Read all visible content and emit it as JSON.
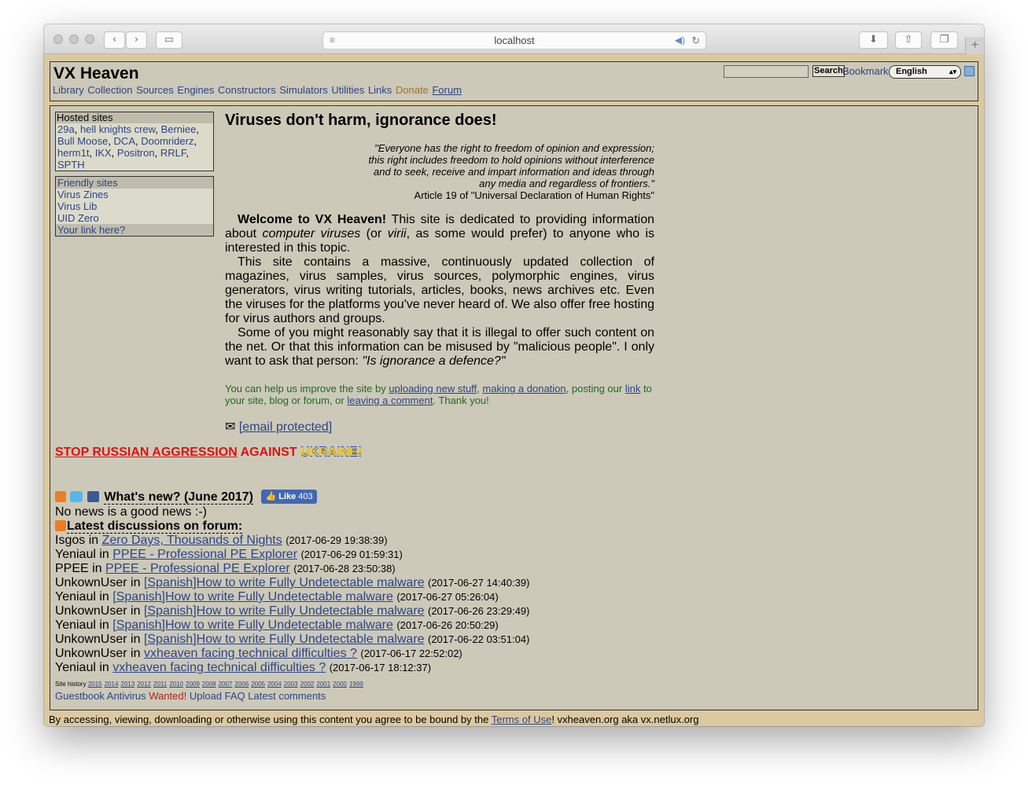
{
  "browser": {
    "url": "localhost"
  },
  "header": {
    "site_title": "VX Heaven",
    "menu": [
      "Library",
      "Collection",
      "Sources",
      "Engines",
      "Constructors",
      "Simulators",
      "Utilities",
      "Links"
    ],
    "donate": "Donate",
    "forum": "Forum",
    "search_button": "Search",
    "bookmark": "Bookmark",
    "language": "English"
  },
  "sidebar": {
    "hosted_title": "Hosted sites",
    "hosted_sites": [
      "29a",
      "hell knights crew",
      "Berniee",
      "Bull Moose",
      "DCA",
      "Doomriderz",
      "herm1t",
      "IKX",
      "Positron",
      "RRLF",
      "SPTH"
    ],
    "friendly_title": "Friendly sites",
    "friendly_sites": [
      "Virus Zines",
      "Virus Lib",
      "UID Zero",
      "Your link here?"
    ]
  },
  "content": {
    "headline": "Viruses don't harm, ignorance does!",
    "quote_lines": [
      "\"Everyone has the right to freedom of opinion and expression;",
      "this right includes freedom to hold opinions without interference",
      "and to seek, receive and impart information and ideas through",
      "any media and regardless of frontiers.\""
    ],
    "quote_source": "Article 19 of \"Universal Declaration of Human Rights\"",
    "welcome_bold": "Welcome to VX Heaven!",
    "welcome_p1_a": " This site is dedicated to providing information about ",
    "welcome_p1_em1": "computer viruses",
    "welcome_p1_b": " (or ",
    "welcome_p1_em2": "virii",
    "welcome_p1_c": ", as some would prefer) to anyone who is interested in this topic.",
    "welcome_p2": "This site contains a massive, continuously updated collection of magazines, virus samples, virus sources, polymorphic engines, virus generators, virus writing tutorials, articles, books, news archives etc. Even the viruses for the platforms you've never heard of. We also offer free hosting for virus authors and groups.",
    "welcome_p3_a": "Some of you might reasonably say that it is illegal to offer such content on the net. Or that this information can be misused by \"malicious people\". I only want to ask that person: ",
    "welcome_p3_em": "\"Is ignorance a defence?\"",
    "help_a": "You can help us improve the site by ",
    "help_link1": "uploading new stuff",
    "help_b": ", ",
    "help_link2": "making a donation",
    "help_c": ", posting our ",
    "help_link3": "link",
    "help_d": " to your site, blog or forum, or ",
    "help_link4": "leaving a comment",
    "help_e": ". Thank you!",
    "email_icon": "✉",
    "email_link": "[email protected]"
  },
  "banner": {
    "part1": "STOP RUSSIAN AGGRESSION",
    "part2": " AGAINST ",
    "part3": "UKRAINE!"
  },
  "news": {
    "whats_new": "What's new? (June 2017)",
    "like_label": "Like",
    "like_count": "403",
    "no_news": "No news is a good news :-)",
    "forum_title": "Latest discussions on forum:",
    "posts": [
      {
        "user": "Isgos",
        "topic": "Zero Days, Thousands of Nights",
        "time": "(2017-06-29 19:38:39)"
      },
      {
        "user": "Yeniaul",
        "topic": "PPEE - Professional PE Explorer",
        "time": "(2017-06-29 01:59:31)"
      },
      {
        "user": "PPEE",
        "topic": "PPEE - Professional PE Explorer",
        "time": "(2017-06-28 23:50:38)"
      },
      {
        "user": "UnkownUser",
        "topic": "[Spanish]How to write Fully Undetectable malware",
        "time": "(2017-06-27 14:40:39)"
      },
      {
        "user": "Yeniaul",
        "topic": "[Spanish]How to write Fully Undetectable malware",
        "time": "(2017-06-27 05:26:04)"
      },
      {
        "user": "UnkownUser",
        "topic": "[Spanish]How to write Fully Undetectable malware",
        "time": "(2017-06-26 23:29:49)"
      },
      {
        "user": "Yeniaul",
        "topic": "[Spanish]How to write Fully Undetectable malware",
        "time": "(2017-06-26 20:50:29)"
      },
      {
        "user": "UnkownUser",
        "topic": "[Spanish]How to write Fully Undetectable malware",
        "time": "(2017-06-22 03:51:04)"
      },
      {
        "user": "UnkownUser",
        "topic": "vxheaven facing technical difficulties ?",
        "time": "(2017-06-17 22:52:02)"
      },
      {
        "user": "Yeniaul",
        "topic": "vxheaven facing technical difficulties ?",
        "time": "(2017-06-17 18:12:37)"
      }
    ],
    "in_word": " in "
  },
  "history": {
    "label": "Site history",
    "years": [
      "2015",
      "2014",
      "2013",
      "2012",
      "2011",
      "2010",
      "2009",
      "2008",
      "2007",
      "2006",
      "2005",
      "2004",
      "2003",
      "2002",
      "2001",
      "2000",
      "1999"
    ]
  },
  "bottom_links": {
    "guestbook": "Guestbook",
    "antivirus": "Antivirus",
    "wanted": "Wanted!",
    "upload": "Upload",
    "faq": "FAQ",
    "latest_comments": "Latest comments"
  },
  "footer": {
    "text_a": "By accessing, viewing, downloading or otherwise using this content you agree to be bound by the ",
    "terms": "Terms of Use",
    "text_b": "! vxheaven.org aka vx.netlux.org"
  }
}
